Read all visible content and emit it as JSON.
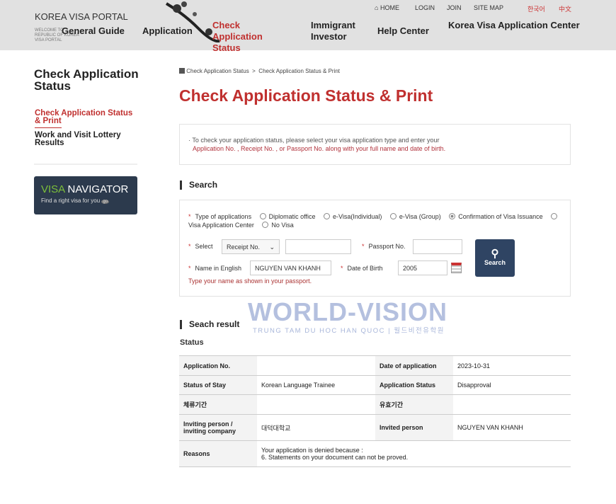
{
  "header": {
    "logo": "KOREA VISA PORTAL",
    "welcome": "WELCOME TO REPUBLIC OF KOREA VISA PORTAL",
    "util": {
      "home": "HOME",
      "login": "LOGIN",
      "join": "JOIN",
      "sitemap": "SITE MAP",
      "korean": "한국어",
      "chinese": "中文"
    },
    "nav": [
      "General Guide",
      "Application",
      "Check Application Status",
      "Immigrant Investor",
      "Help Center",
      "Korea Visa Application Center"
    ]
  },
  "sidebar": {
    "title": "Check Application Status",
    "items": [
      {
        "label": "Check Application Status & Print",
        "active": true
      },
      {
        "label": "Work and Visit Lottery Results"
      }
    ],
    "banner": {
      "visa": "VISA",
      "navigator": "NAVIGATOR",
      "sub": "Find a right visa for you",
      "go": "go"
    }
  },
  "breadcrumb": [
    "Check Application Status",
    "Check Application Status & Print"
  ],
  "page_title": "Check Application Status & Print",
  "notice": {
    "line1": "· To check your application status, please select your visa application type and enter your",
    "line2": "Application No. , Receipt No. , or Passport No. along with your full name and date of birth."
  },
  "search": {
    "heading": "Search",
    "type_label": "Type of applications",
    "types": [
      {
        "label": "Diplomatic office",
        "checked": false
      },
      {
        "label": "e-Visa(Individual)",
        "checked": false
      },
      {
        "label": "e-Visa (Group)",
        "checked": false
      },
      {
        "label": "Confirmation of Visa Issuance",
        "checked": true
      },
      {
        "label": "Visa Application Center",
        "checked": false
      },
      {
        "label": "No Visa",
        "checked": false
      }
    ],
    "select_label": "Select",
    "select_value": "Receipt No.",
    "number_value": "",
    "passport_label": "Passport No.",
    "passport_value": "",
    "name_label": "Name in English",
    "name_value": "NGUYEN VAN KHANH",
    "dob_label": "Date of Birth",
    "dob_value": "2005",
    "hint": "Type your name as shown in your passport.",
    "button": "Search"
  },
  "result": {
    "heading": "Seach result",
    "subheading": "Status",
    "rows": [
      [
        "Application No.",
        "",
        "Date of application",
        "2023-10-31"
      ],
      [
        "Status of Stay",
        "Korean Language Trainee",
        "Application Status",
        "Disapproval"
      ],
      [
        "체류기간",
        "",
        "유효기간",
        ""
      ],
      [
        "Inviting person / inviting company",
        "대덕대학교",
        "Invited person",
        "NGUYEN VAN KHANH"
      ]
    ],
    "reasons_label": "Reasons",
    "reasons_1": "Your application is denied because :",
    "reasons_2": "6. Statements on your document can not be proved."
  },
  "watermark": {
    "title": "WORLD-VISION",
    "sub": "TRUNG TAM DU HOC HAN QUOC | 월드비전유학원"
  },
  "colors": {
    "accent": "#c0302f",
    "header_bg": "#e1e1e1",
    "button": "#2f4463"
  }
}
